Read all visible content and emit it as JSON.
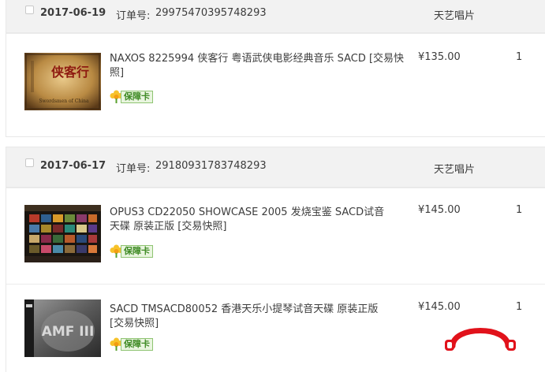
{
  "currency_prefix": "¥",
  "orders": [
    {
      "date": "2017-06-19",
      "order_no_label": "订单号:",
      "order_no": "29975470395748293",
      "shop": "天艺唱片",
      "items": [
        {
          "title": "NAXOS 8225994 侠客行 粤语武侠电影经典音乐 SACD [交易快照]",
          "badge": "保障卡",
          "price": "¥135.00",
          "qty": "1",
          "cover_text": "侠客行",
          "cover_sub": "Swordsmen of China"
        }
      ]
    },
    {
      "date": "2017-06-17",
      "order_no_label": "订单号:",
      "order_no": "29180931783748293",
      "shop": "天艺唱片",
      "items": [
        {
          "title": "OPUS3 CD22050 SHOWCASE 2005 发烧宝鉴 SACD试音天碟 原装正版 [交易快照]",
          "badge": "保障卡",
          "price": "¥145.00",
          "qty": "1"
        },
        {
          "title": "SACD TMSACD80052 香港天乐小提琴试音天碟 原装正版 [交易快照]",
          "badge": "保障卡",
          "price": "¥145.00",
          "qty": "1",
          "cover_text": "AMF III"
        }
      ]
    }
  ],
  "colors": {
    "header_bg": "#f2f2f2",
    "badge_green": "#3e8a24",
    "logo_red": "#e1121b"
  }
}
